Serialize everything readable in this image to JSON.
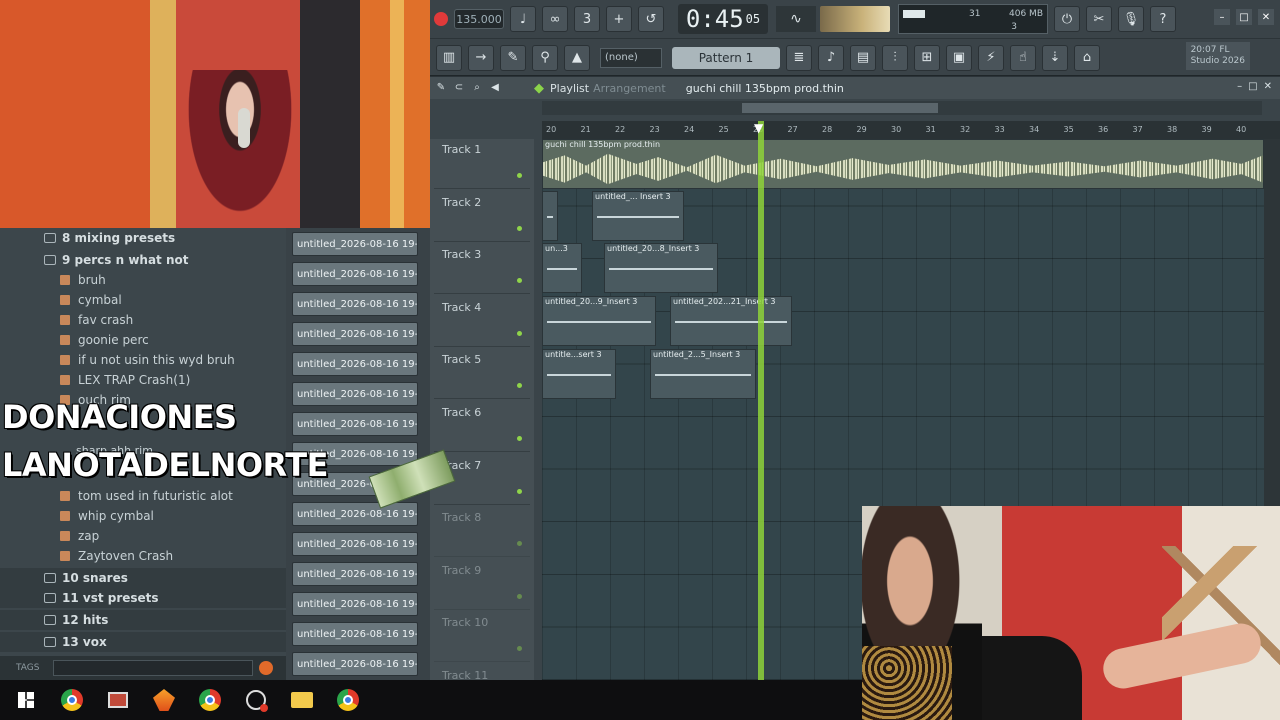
{
  "toolbar": {
    "tempo": "135.000",
    "time_main": "0:45",
    "time_sub": "05",
    "monitor_value": "31",
    "memory": "406 MB",
    "polyphony": "3",
    "pattern_none": "(none)",
    "pattern_selected": "Pattern 1",
    "studio_line1": "20:07 FL",
    "studio_line2": "Studio 2026"
  },
  "playlist": {
    "title": "Playlist",
    "section": "Arrangement",
    "song": "guchi chill 135bpm prod.thin",
    "tracks": [
      "Track 1",
      "Track 2",
      "Track 3",
      "Track 4",
      "Track 5",
      "Track 6",
      "Track 7",
      "Track 8",
      "Track 9",
      "Track 10",
      "Track 11"
    ],
    "ticks": [
      "20",
      "21",
      "22",
      "23",
      "24",
      "25",
      "26",
      "27",
      "28",
      "29",
      "30",
      "31",
      "32",
      "33",
      "34",
      "35",
      "36",
      "37",
      "38",
      "39",
      "40"
    ],
    "clips": {
      "main": "guchi chill 135bpm prod.thin",
      "t2a": "",
      "t2b": "untitled_... Insert 3",
      "t3a": "un...3",
      "t3b": "untitled_20...8_Insert 3",
      "t4a": "untitled_20...9_Insert 3",
      "t4b": "untitled_202...21_Insert 3",
      "t5a": "untitle...sert 3",
      "t5b": "untitled_2...5_Insert 3"
    }
  },
  "browser": {
    "items": [
      {
        "label": "8 mixing presets",
        "kind": "folder"
      },
      {
        "label": "9 percs n what not",
        "kind": "folder"
      },
      {
        "label": "bruh",
        "kind": "file"
      },
      {
        "label": "cymbal",
        "kind": "file"
      },
      {
        "label": "fav crash",
        "kind": "file"
      },
      {
        "label": "goonie perc",
        "kind": "file"
      },
      {
        "label": "if u not usin this wyd bruh",
        "kind": "file"
      },
      {
        "label": "LEX TRAP Crash(1)",
        "kind": "file"
      },
      {
        "label": "ouch rim",
        "kind": "file"
      },
      {
        "label": "tom used in futuristic alot",
        "kind": "file"
      },
      {
        "label": "whip cymbal",
        "kind": "file"
      },
      {
        "label": "zap",
        "kind": "file"
      },
      {
        "label": "Zaytoven Crash",
        "kind": "file"
      },
      {
        "label": "10 snares",
        "kind": "folder"
      },
      {
        "label": "11 vst presets",
        "kind": "folder"
      },
      {
        "label": "12 hits",
        "kind": "folder"
      },
      {
        "label": "13 vox",
        "kind": "folder"
      }
    ],
    "search_label": "TAGS",
    "partial_item": "sharp ahh rim"
  },
  "patterns": {
    "items": [
      "untitled_2026-08-16 19-...",
      "untitled_2026-08-16 19-...",
      "untitled_2026-08-16 19-...",
      "untitled_2026-08-16 19-...",
      "untitled_2026-08-16 19-...",
      "untitled_2026-08-16 19-...",
      "untitled_2026-08-16 19-...",
      "untitled_2026-08-16 19-...",
      "untitled_2026-08-16 19-...",
      "untitled_2026-08-16 19-...",
      "untitled_2026-08-16 19-...",
      "untitled_2026-08-16 19-...",
      "untitled_2026-08-16 19-...",
      "untitled_2026-08-16 19-...",
      "untitled_2026-08-16 19-..."
    ]
  },
  "overlay": {
    "line1": "DONACIONES",
    "line2": "LANOTADELNORTE"
  },
  "icons": {
    "record": "record-icon",
    "accent_green": "#8ed23a",
    "record_red": "#e03a3a"
  }
}
